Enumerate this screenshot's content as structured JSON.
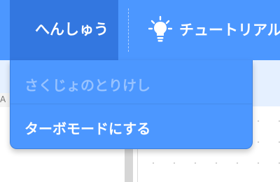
{
  "menubar": {
    "edit_label": "へんしゅう",
    "tutorial_label": "チュートリアル"
  },
  "dropdown": {
    "items": [
      {
        "label": "さくじょのとりけし",
        "enabled": false
      },
      {
        "label": "ターボモードにする",
        "enabled": true
      }
    ]
  },
  "workspace": {
    "edge_text": "A"
  },
  "colors": {
    "menubar": "#4c97ff",
    "menu_active": "#3377e0",
    "dropdown": "#4c97ff",
    "disabled_text": "rgba(255,255,255,0.42)"
  },
  "icons": [
    "lightbulb-icon"
  ]
}
